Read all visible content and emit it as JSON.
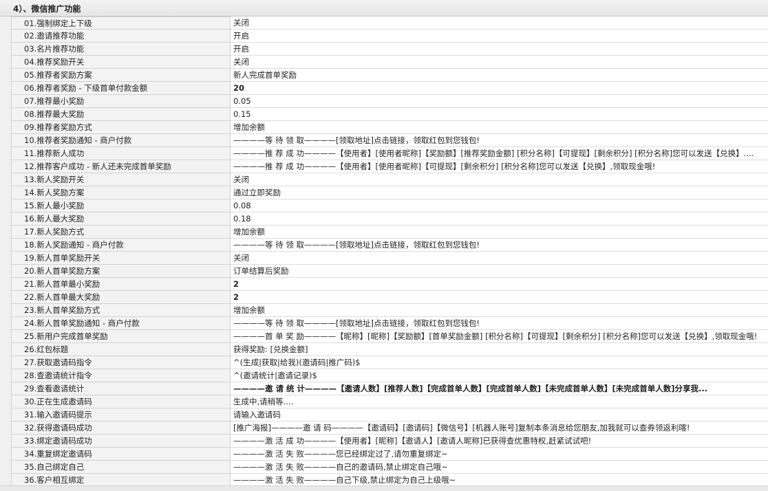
{
  "section": {
    "title": "4）、微信推广功能"
  },
  "rows": [
    {
      "label": "01.强制绑定上下级",
      "value": "关闭",
      "bold": false
    },
    {
      "label": "02.邀请推荐功能",
      "value": "开启",
      "bold": false
    },
    {
      "label": "03.名片推荐功能",
      "value": "开启",
      "bold": false
    },
    {
      "label": "04.推荐奖励开关",
      "value": "关闭",
      "bold": false
    },
    {
      "label": "05.推荐者奖励方案",
      "value": "新人完成首单奖励",
      "bold": false
    },
    {
      "label": "06.推荐者奖励 - 下级首单付款金额",
      "value": "20",
      "bold": true
    },
    {
      "label": "07.推荐最小奖励",
      "value": "0.05",
      "bold": false
    },
    {
      "label": "08.推荐最大奖励",
      "value": "0.15",
      "bold": false
    },
    {
      "label": "09.推荐者奖励方式",
      "value": "增加余额",
      "bold": false
    },
    {
      "label": "10.推荐者奖励通知 - 商户付款",
      "value": "————等 待 领 取————[领取地址]点击链接，领取红包到您钱包!",
      "bold": false
    },
    {
      "label": "11.推荐新人成功",
      "value": "————推 荐 成 功————【使用者】[使用者昵称]【奖励额】[推荐奖励金额] [积分名称]【可提现】[剩余积分] [积分名称]您可以发送【兑换】....",
      "bold": false
    },
    {
      "label": "12.推荐客户成功 - 新人还未完成首单奖励",
      "value": "————推 荐 成 功————【使用者】[使用者昵称]【可提现】[剩余积分] [积分名称]您可以发送【兑换】,领取现金哦!",
      "bold": false
    },
    {
      "label": "13.新人奖励开关",
      "value": "关闭",
      "bold": false
    },
    {
      "label": "14.新人奖励方案",
      "value": "通过立即奖励",
      "bold": false
    },
    {
      "label": "15.新人最小奖励",
      "value": "0.08",
      "bold": false
    },
    {
      "label": "16.新人最大奖励",
      "value": "0.18",
      "bold": false
    },
    {
      "label": "17.新人奖励方式",
      "value": "增加余额",
      "bold": false
    },
    {
      "label": "18.新人奖励通知 - 商户付款",
      "value": "————等 待 领 取————[领取地址]点击链接，领取红包到您钱包!",
      "bold": false
    },
    {
      "label": "19.新人首单奖励开关",
      "value": "关闭",
      "bold": false
    },
    {
      "label": "20.新人首单奖励方案",
      "value": "订单结算后奖励",
      "bold": false
    },
    {
      "label": "21.新人首单最小奖励",
      "value": "2",
      "bold": true
    },
    {
      "label": "22.新人首单最大奖励",
      "value": "2",
      "bold": true
    },
    {
      "label": "23.新人首单奖励方式",
      "value": "增加余额",
      "bold": false
    },
    {
      "label": "24.新人首单奖励通知 - 商户付款",
      "value": "————等 待 领 取————[领取地址]点击链接，领取红包到您钱包!",
      "bold": false
    },
    {
      "label": "25.新用户完成首单奖励",
      "value": "————首 单 奖 励————【昵称】[昵称]【奖励额】[首单奖励金额] [积分名称]【可提现】[剩余积分] [积分名称]您可以发送【兑换】,领取现金哦!",
      "bold": false
    },
    {
      "label": "26.红包标题",
      "value": "获得奖励: [兑换金额]",
      "bold": false
    },
    {
      "label": "27.获取邀请码指令",
      "value": "^(生成|获取|给我)(邀请码|推广码)$",
      "bold": false
    },
    {
      "label": "28.查邀请统计指令",
      "value": "^(邀请统计|邀请记录)$",
      "bold": false
    },
    {
      "label": "29.查看邀请统计",
      "value": "————邀 请 统 计————【邀请人数】[推荐人数]【完成首单人数】[完成首单人数]【未完成首单人数】[未完成首单人数]分享我...",
      "bold": true
    },
    {
      "label": "30.正在生成邀请码",
      "value": "生成中,请稍等....",
      "bold": false
    },
    {
      "label": "31.输入邀请码提示",
      "value": "请输入邀请码",
      "bold": false
    },
    {
      "label": "32.获得邀请码成功",
      "value": "[推广海报]————邀 请 码————【邀请码】[邀请码]【微信号】[机器人账号]复制本条消息给您朋友,加我就可以查券领返利喀!",
      "bold": false
    },
    {
      "label": "33.绑定邀请码成功",
      "value": "————激 活 成 功————【使用者】[昵称]【邀请人】[邀请人昵称]已获得查优惠特权,赶紧试试吧!",
      "bold": false
    },
    {
      "label": "34.重复绑定邀请码",
      "value": "————激 活 失 败————您已经绑定过了,请勿重复绑定~",
      "bold": false
    },
    {
      "label": "35.自己绑定自己",
      "value": "————激 活 失 败————自己的邀请码,禁止绑定自己哦~",
      "bold": false
    },
    {
      "label": "36.客户相互绑定",
      "value": "————激 活 失 败————自己下级,禁止绑定为自己上级哦~",
      "bold": false
    }
  ]
}
